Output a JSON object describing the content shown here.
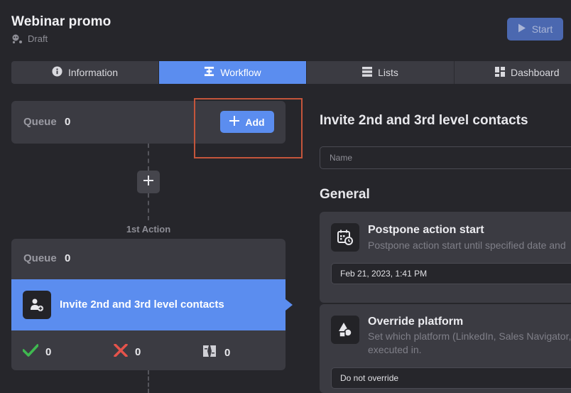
{
  "header": {
    "title": "Webinar promo",
    "status": "Draft",
    "start_label": "Start"
  },
  "tabs": [
    {
      "label": "Information",
      "icon": "info-icon"
    },
    {
      "label": "Workflow",
      "icon": "workflow-icon",
      "active": true
    },
    {
      "label": "Lists",
      "icon": "list-icon"
    },
    {
      "label": "Dashboard",
      "icon": "dashboard-icon"
    }
  ],
  "queue": {
    "label": "Queue",
    "count": "0",
    "add_label": "Add"
  },
  "first_action_label": "1st Action",
  "action": {
    "queue_label": "Queue",
    "queue_count": "0",
    "name": "Invite 2nd and 3rd level contacts",
    "success_count": "0",
    "failed_count": "0",
    "skipped_count": "0"
  },
  "panel": {
    "title": "Invite 2nd and 3rd level contacts",
    "name_placeholder": "Name",
    "general_heading": "General",
    "settings": [
      {
        "title": "Postpone action start",
        "desc": "Postpone action start until specified date and",
        "value": "Feb 21, 2023, 1:41 PM"
      },
      {
        "title": "Override platform",
        "desc_line1": "Set which platform (LinkedIn, Sales Navigator,",
        "desc_line2": "executed in.",
        "value": "Do not override"
      }
    ]
  },
  "colors": {
    "background": "#26262b",
    "card": "#3b3b42",
    "accent": "#5b8def",
    "highlight": "#c4553b",
    "success": "#3fb950",
    "error": "#e5534b"
  }
}
